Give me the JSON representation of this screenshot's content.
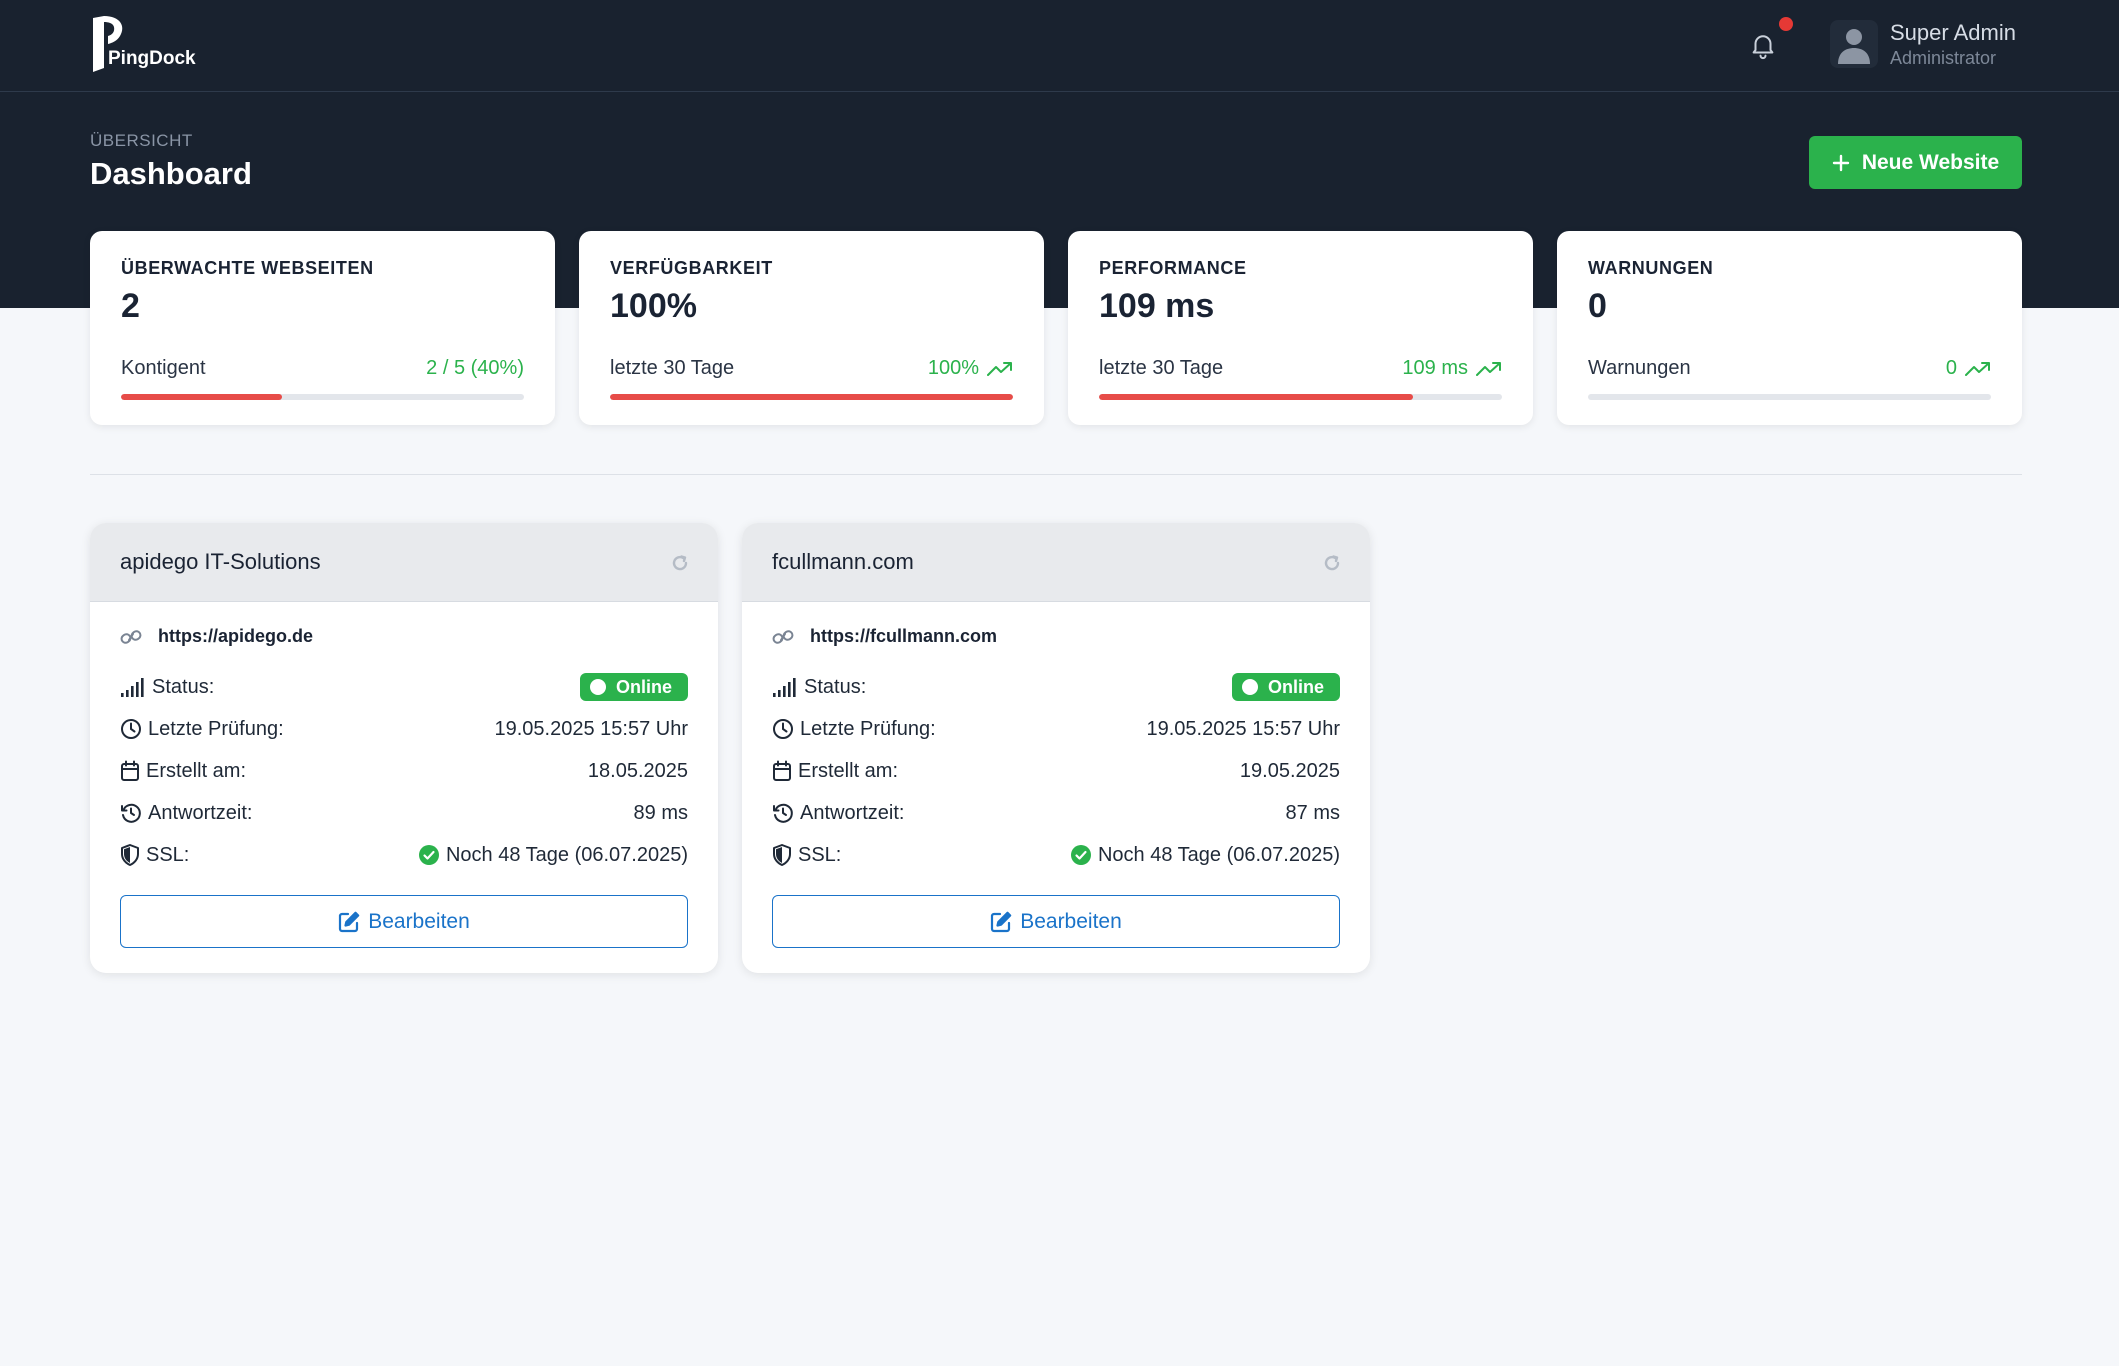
{
  "app": {
    "name": "PingDock"
  },
  "header": {
    "user_name": "Super Admin",
    "user_role": "Administrator",
    "has_notification": true
  },
  "page": {
    "eyebrow": "ÜBERSICHT",
    "title": "Dashboard",
    "new_button_label": "Neue Website"
  },
  "stats": [
    {
      "label": "ÜBERWACHTE WEBSEITEN",
      "value": "2",
      "sub": "Kontigent",
      "trend": "2 / 5 (40%)",
      "trend_icon": false,
      "progress": 0.4
    },
    {
      "label": "VERFÜGBARKEIT",
      "value": "100%",
      "sub": "letzte 30 Tage",
      "trend": "100%",
      "trend_icon": true,
      "progress": 1.0
    },
    {
      "label": "PERFORMANCE",
      "value": "109 ms",
      "sub": "letzte 30 Tage",
      "trend": "109 ms",
      "trend_icon": true,
      "progress": 0.78
    },
    {
      "label": "WARNUNGEN",
      "value": "0",
      "sub": "Warnungen",
      "trend": "0",
      "trend_icon": true,
      "progress": 0.0
    }
  ],
  "labels": {
    "status": "Status:",
    "last_check": "Letzte Prüfung:",
    "created": "Erstellt am:",
    "response": "Antwortzeit:",
    "ssl": "SSL:",
    "edit": "Bearbeiten"
  },
  "sites": [
    {
      "name": "apidego IT-Solutions",
      "url": "https://apidego.de",
      "status": "Online",
      "last_check": "19.05.2025 15:57 Uhr",
      "created": "18.05.2025",
      "response": "89 ms",
      "ssl": "Noch 48 Tage (06.07.2025)"
    },
    {
      "name": "fcullmann.com",
      "url": "https://fcullmann.com",
      "status": "Online",
      "last_check": "19.05.2025 15:57 Uhr",
      "created": "19.05.2025",
      "response": "87 ms",
      "ssl": "Noch 48 Tage (06.07.2025)"
    }
  ],
  "colors": {
    "header_bg": "#19222f",
    "accent_green": "#2bb24c",
    "progress_red": "#e74c48",
    "link_blue": "#1a73c9",
    "notification_red": "#e53935"
  },
  "icons": {
    "logo": "pingdock-logo-icon",
    "notifications": "bell-icon",
    "user": "user-avatar-icon",
    "new": "plus-icon",
    "trend": "trending-up-icon",
    "refresh": "refresh-icon",
    "link": "link-icon",
    "status": "signal-icon",
    "last_check": "clock-icon",
    "created": "calendar-icon",
    "response": "history-icon",
    "ssl": "shield-icon",
    "ssl_ok": "check-circle-icon",
    "edit": "edit-icon"
  }
}
